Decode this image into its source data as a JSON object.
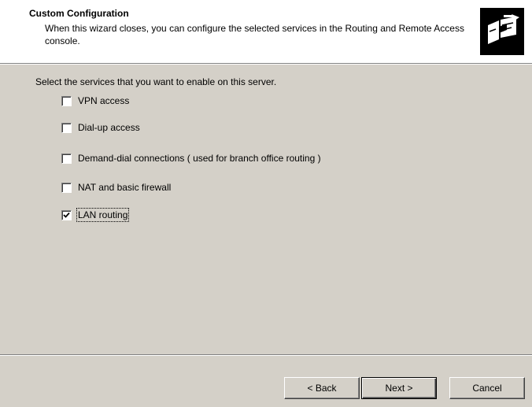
{
  "header": {
    "title": "Custom Configuration",
    "description": "When this wizard closes, you can configure the selected services in the Routing and Remote Access console.",
    "icon": "network-wizard-icon"
  },
  "prompt": "Select the services that you want to enable on this server.",
  "options": [
    {
      "label": "VPN access",
      "checked": false
    },
    {
      "label": "Dial-up access",
      "checked": false
    },
    {
      "label": "Demand-dial connections ( used for branch office routing )",
      "checked": false
    },
    {
      "label": "NAT and basic firewall",
      "checked": false
    },
    {
      "label": "LAN routing",
      "checked": true
    }
  ],
  "buttons": {
    "back": "< Back",
    "next": "Next >",
    "cancel": "Cancel"
  },
  "colors": {
    "dialog_bg": "#d4d0c8",
    "header_bg": "#ffffff"
  }
}
